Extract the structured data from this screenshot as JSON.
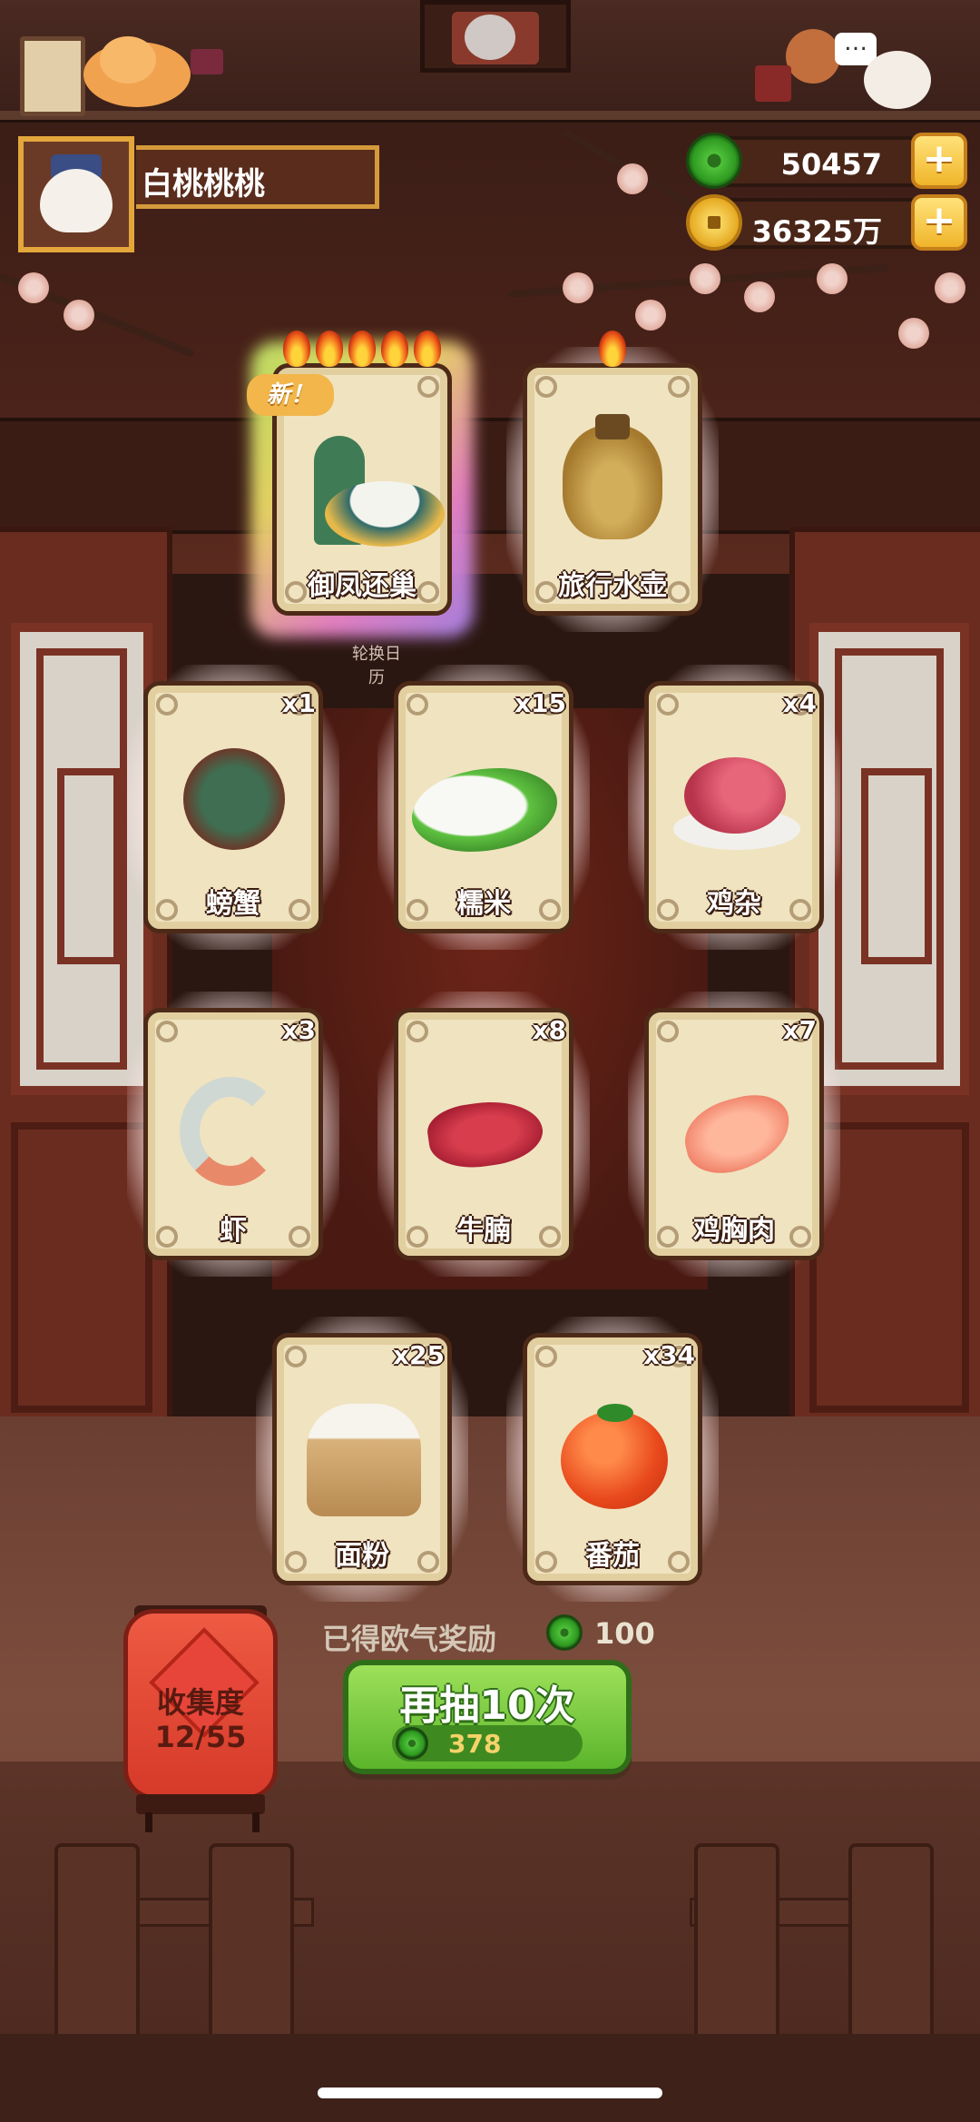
{
  "player": {
    "name": "白桃桃桃"
  },
  "currencies": {
    "jade": {
      "value": "50457",
      "icon": "jade-icon"
    },
    "coins": {
      "value": "36325万",
      "icon": "coin-icon"
    }
  },
  "special_cards": [
    {
      "name": "御凤还巢",
      "flames": 5,
      "is_new": true,
      "new_label": "新！",
      "art": "phoenix-dish-icon"
    },
    {
      "name": "旅行水壶",
      "flames": 1,
      "is_new": false,
      "art": "gourd-icon"
    }
  ],
  "calendar_label": "轮换日历",
  "cards": [
    {
      "name": "螃蟹",
      "count": "x1",
      "art": "crab-icon"
    },
    {
      "name": "糯米",
      "count": "x15",
      "art": "rice-icon"
    },
    {
      "name": "鸡杂",
      "count": "x4",
      "art": "chicken-giblets-icon"
    },
    {
      "name": "虾",
      "count": "x3",
      "art": "shrimp-icon"
    },
    {
      "name": "牛腩",
      "count": "x8",
      "art": "beef-icon"
    },
    {
      "name": "鸡胸肉",
      "count": "x7",
      "art": "chicken-breast-icon"
    },
    {
      "name": "面粉",
      "count": "x25",
      "art": "flour-icon"
    },
    {
      "name": "番茄",
      "count": "x34",
      "art": "tomato-icon"
    }
  ],
  "reward": {
    "label": "已得欧气奖励",
    "value": "100"
  },
  "collection": {
    "label": "收集度",
    "value": "12/55"
  },
  "draw_button": {
    "label": "再抽10次",
    "cost": "378"
  },
  "colors": {
    "accent_gold": "#e3a63b",
    "button_green": "#5bb52b",
    "card_bg": "#f0e3c0",
    "lantern_red": "#d63a29"
  }
}
